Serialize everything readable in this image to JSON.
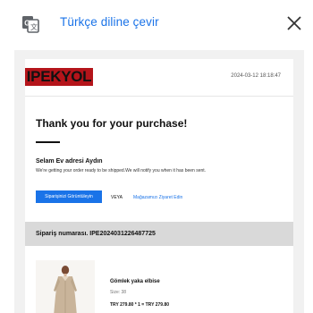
{
  "translate_bar": {
    "label": "Türkçe diline çevir",
    "icon": "google-translate-icon",
    "close_icon": "close-icon",
    "accent": "#1a73e8"
  },
  "email": {
    "brand": "IPEKYOL",
    "brand_color": "#b4141a",
    "date": "2024-03-12 18:18:47",
    "title": "Thank you for your purchase!",
    "greeting": "Selam Ev adresi Aydın",
    "subtitle": "We're getting your order ready to be shipped.We will notify you when it has been sent.",
    "primary_button": "Siparişinizi Görüntüleyin",
    "or": "VEYA",
    "store_link": "Mağazamızı Ziyaret Edin",
    "order_label": "Sipariş numarası. IPE2024031226487725",
    "product": {
      "name": "Gömlek yaka elbise",
      "size": "Size: 38",
      "price": "TRY 279.80 * 1 = TRY 279.80"
    }
  }
}
